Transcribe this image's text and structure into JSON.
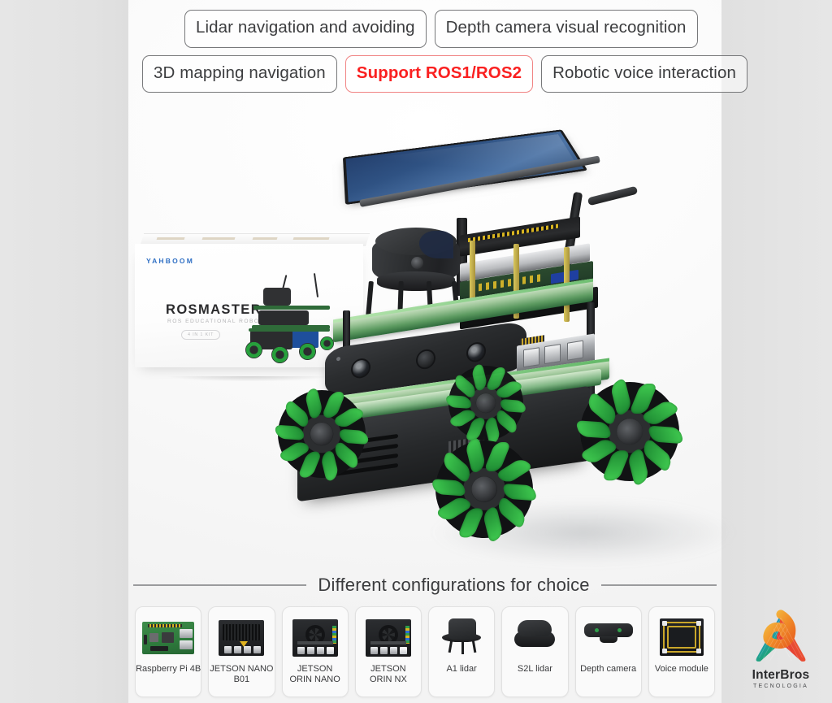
{
  "features": {
    "row1": [
      {
        "label": "Lidar navigation and avoiding",
        "accent": false
      },
      {
        "label": "Depth camera visual recognition",
        "accent": false
      }
    ],
    "row2": [
      {
        "label": "3D mapping navigation",
        "accent": false
      },
      {
        "label": "Support ROS1/ROS2",
        "accent": true
      },
      {
        "label": "Robotic voice interaction",
        "accent": false
      }
    ]
  },
  "package": {
    "brand": "YAHBOOM",
    "product": "ROSMASTER",
    "subtitle": "ROS EDUCATIONAL ROBOT",
    "badge": "4 IN 1  KIT"
  },
  "configurations": {
    "heading": "Different configurations for choice",
    "cards": [
      {
        "label": "Raspberry Pi 4B",
        "thumb": "raspberry-pi-board"
      },
      {
        "label": "JETSON NANO\nB01",
        "thumb": "jetson-nano-board"
      },
      {
        "label": "JETSON\nORIN NANO",
        "thumb": "jetson-orin-board"
      },
      {
        "label": "JETSON\nORIN NX",
        "thumb": "jetson-orin-board"
      },
      {
        "label": "A1 lidar",
        "thumb": "a1-lidar"
      },
      {
        "label": "S2L lidar",
        "thumb": "s2l-lidar"
      },
      {
        "label": "Depth camera",
        "thumb": "depth-camera"
      },
      {
        "label": "Voice module",
        "thumb": "voice-module"
      }
    ]
  },
  "logo": {
    "brand": "InterBros",
    "tagline": "TECNOLOGIA"
  },
  "colors": {
    "accent_red": "#fa2020",
    "tag_border": "#77787a",
    "text_dark": "#3c3d3f",
    "deck_green": "#2f6b3c",
    "wheel_green": "#27a03c",
    "battery_blue": "#1f56ad",
    "display_blue": "#2f5283",
    "yahboom_blue": "#2f6fc4",
    "panel_bg": "#ffffff",
    "page_bg": "#e4e4e4"
  }
}
